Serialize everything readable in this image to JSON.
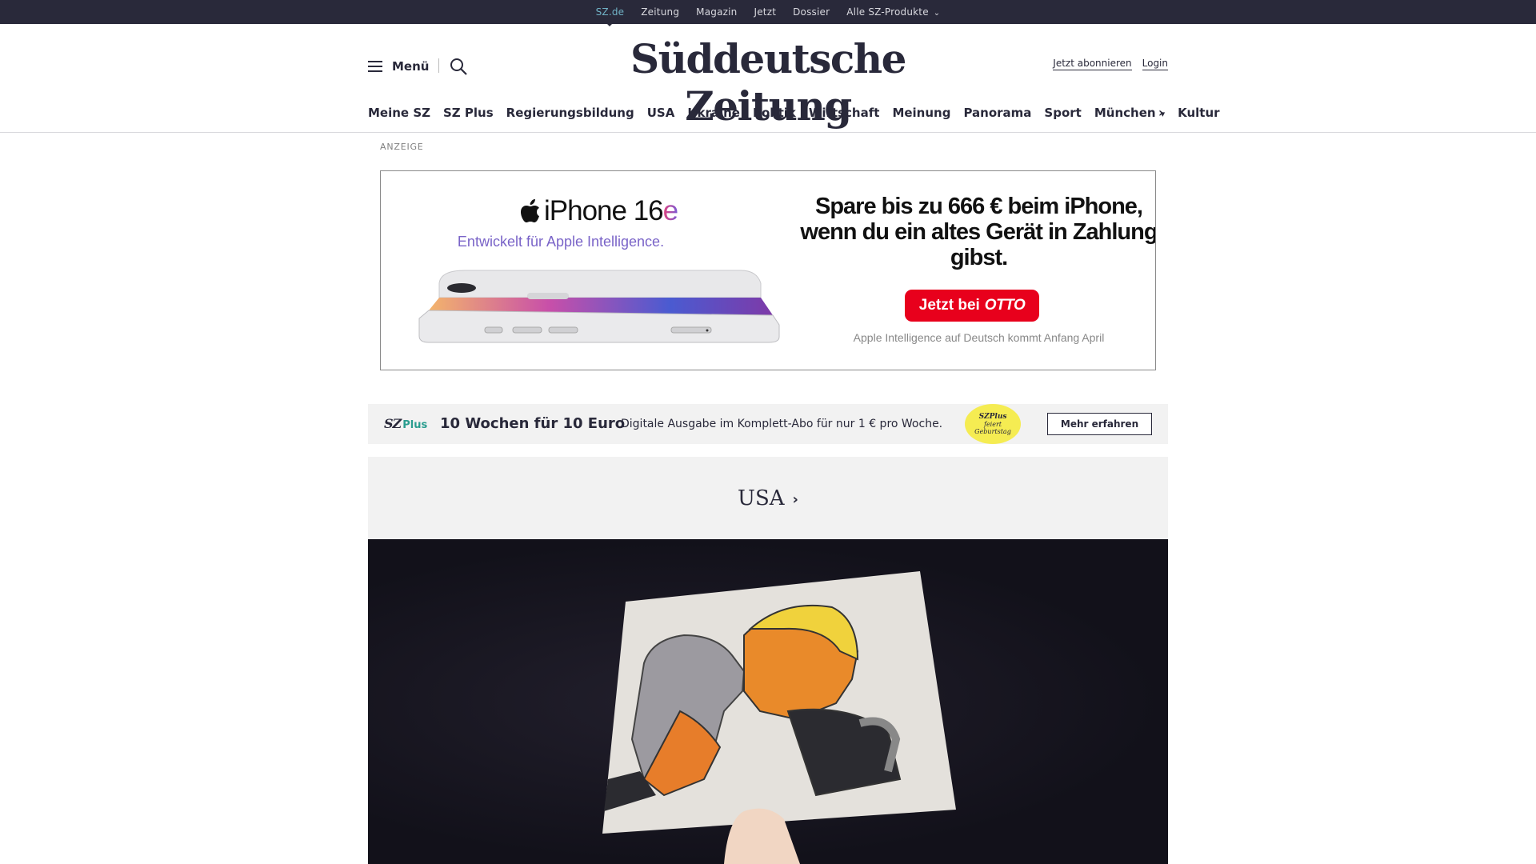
{
  "topbar": {
    "items": [
      "SZ.de",
      "Zeitung",
      "Magazin",
      "Jetzt",
      "Dossier",
      "Alle SZ-Produkte"
    ]
  },
  "header": {
    "menu_label": "Menü",
    "logo": "Süddeutsche Zeitung",
    "subscribe": "Jetzt abonnieren",
    "login": "Login"
  },
  "ressort": {
    "items": [
      "Meine SZ",
      "SZ Plus",
      "Regierungsbildung",
      "USA",
      "Ukraine",
      "Politik",
      "Wirtschaft",
      "Meinung",
      "Panorama",
      "Sport",
      "München",
      "Kultur"
    ]
  },
  "ad": {
    "label": "ANZEIGE",
    "model": "iPhone 16",
    "model_suffix": "e",
    "claim": "Entwickelt für Apple Intelligence.",
    "headline": "Spare bis zu 666 € beim iPhone, wenn du ein altes Gerät in Zahlung gibst.",
    "cta_prefix": "Jetzt bei",
    "cta_brand": "OTTO",
    "footnote": "Apple Intelligence auf Deutsch kommt Anfang April"
  },
  "promo": {
    "logo": "SZ",
    "logo_suffix": "Plus",
    "title": "10 Wochen für 10 Euro",
    "text": "Digitale Ausgabe im Komplett-Abo für nur 1 € pro Woche.",
    "badge_line1": "SZPlus",
    "badge_line2": "feiert",
    "badge_line3": "Geburtstag",
    "button": "Mehr erfahren"
  },
  "section": {
    "title": "USA"
  },
  "colors": {
    "topbar_bg": "#29293a",
    "active_link": "#71b3c7",
    "otto_red": "#e8001c",
    "promo_bg": "#f2f2f2",
    "badge_yellow": "#f5ec52"
  }
}
